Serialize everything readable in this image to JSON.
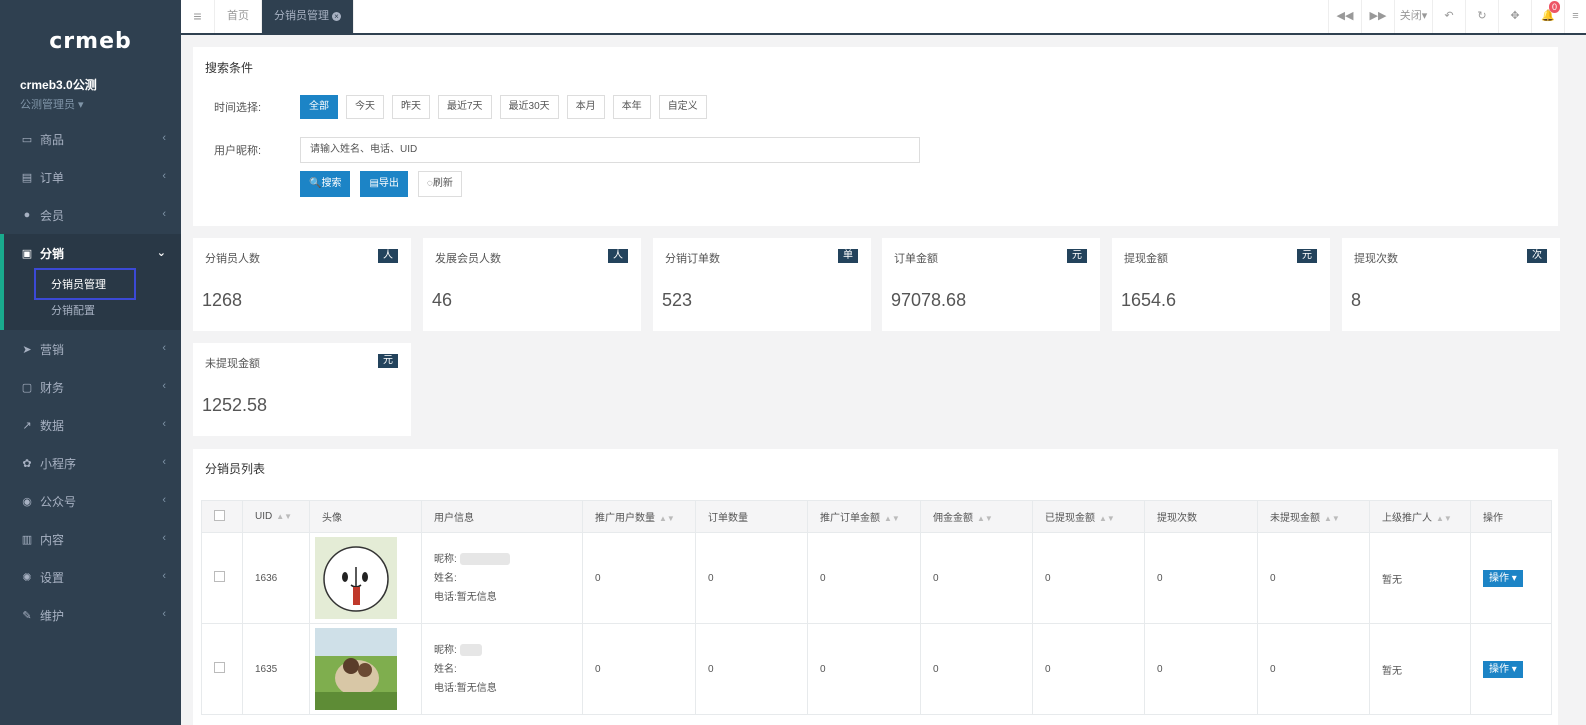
{
  "sidebar": {
    "logo": "crmeb",
    "profile_name": "crmeb3.0公测",
    "profile_role": "公测管理员 ▾",
    "items": [
      {
        "label": "商品",
        "icon": "▭"
      },
      {
        "label": "订单",
        "icon": "▤"
      },
      {
        "label": "会员",
        "icon": "●"
      },
      {
        "label": "分销",
        "icon": "▣"
      },
      {
        "label": "营销",
        "icon": "➤"
      },
      {
        "label": "财务",
        "icon": "▢"
      },
      {
        "label": "数据",
        "icon": "↗"
      },
      {
        "label": "小程序",
        "icon": "✿"
      },
      {
        "label": "公众号",
        "icon": "◉"
      },
      {
        "label": "内容",
        "icon": "▥"
      },
      {
        "label": "设置",
        "icon": "✺"
      },
      {
        "label": "维护",
        "icon": "✎"
      }
    ],
    "submenu": [
      "分销员管理",
      "分销配置"
    ]
  },
  "topbar": {
    "tabs": [
      "首页",
      "分销员管理"
    ],
    "close_label": "关闭▾",
    "notification_count": "0"
  },
  "search": {
    "title": "搜索条件",
    "time_label": "时间选择:",
    "time_options": [
      "全部",
      "今天",
      "昨天",
      "最近7天",
      "最近30天",
      "本月",
      "本年",
      "自定义"
    ],
    "nickname_label": "用户昵称:",
    "nickname_placeholder": "请输入姓名、电话、UID",
    "search_btn": "🔍搜索",
    "export_btn": "▤导出",
    "refresh_btn": "◌刷新"
  },
  "stats": [
    {
      "title": "分销员人数",
      "badge": "人",
      "value": "1268"
    },
    {
      "title": "发展会员人数",
      "badge": "人",
      "value": "46"
    },
    {
      "title": "分销订单数",
      "badge": "单",
      "value": "523"
    },
    {
      "title": "订单金额",
      "badge": "元",
      "value": "97078.68"
    },
    {
      "title": "提现金额",
      "badge": "元",
      "value": "1654.6"
    },
    {
      "title": "提现次数",
      "badge": "次",
      "value": "8"
    },
    {
      "title": "未提现金额",
      "badge": "元",
      "value": "1252.58"
    }
  ],
  "list": {
    "title": "分销员列表",
    "columns": [
      "UID",
      "头像",
      "用户信息",
      "推广用户数量",
      "订单数量",
      "推广订单金额",
      "佣金金额",
      "已提现金额",
      "提现次数",
      "未提现金额",
      "上级推广人",
      "操作"
    ],
    "rows": [
      {
        "uid": "1636",
        "nickname_label": "昵称:",
        "name_label": "姓名:",
        "phone_label": "电话:",
        "phone": "暂无信息",
        "promote_users": "0",
        "orders": "0",
        "promote_amount": "0",
        "commission": "0",
        "withdrawn": "0",
        "withdraw_count": "0",
        "not_withdrawn": "0",
        "superior": "暂无",
        "action": "操作 ▾"
      },
      {
        "uid": "1635",
        "nickname_label": "昵称:",
        "name_label": "姓名:",
        "phone_label": "电话:",
        "phone": "暂无信息",
        "promote_users": "0",
        "orders": "0",
        "promote_amount": "0",
        "commission": "0",
        "withdrawn": "0",
        "withdraw_count": "0",
        "not_withdrawn": "0",
        "superior": "暂无",
        "action": "操作 ▾"
      }
    ]
  },
  "colors": {
    "sidebar_bg": "#2f4050",
    "primary": "#1c84c6",
    "badge_bg": "#23435c",
    "highlight_outline": "#3b49d6"
  }
}
